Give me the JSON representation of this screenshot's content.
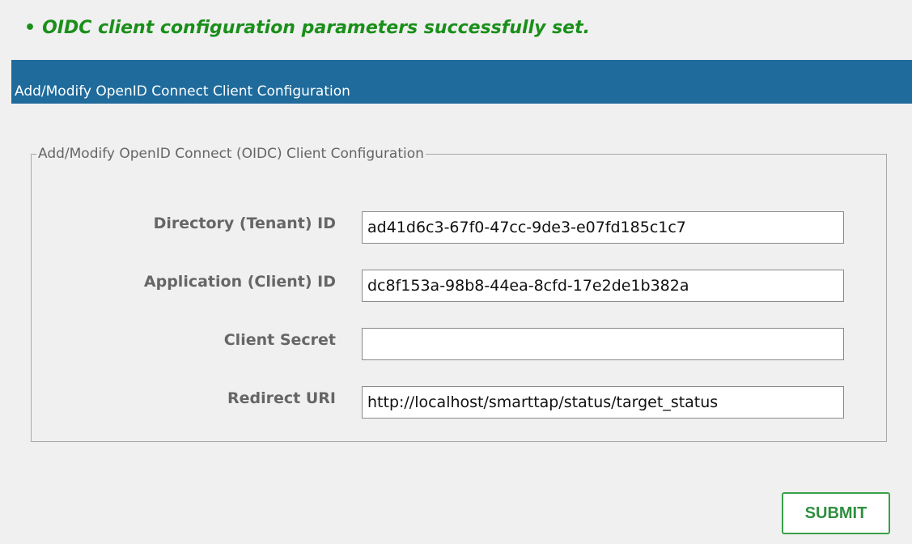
{
  "status": {
    "bullet": "•",
    "message": "OIDC client configuration parameters successfully set."
  },
  "panel": {
    "title": "Add/Modify OpenID Connect Client Configuration"
  },
  "form": {
    "legend": "Add/Modify OpenID Connect (OIDC) Client Configuration",
    "fields": [
      {
        "label": "Directory (Tenant) ID",
        "value": "ad41d6c3-67f0-47cc-9de3-e07fd185c1c7"
      },
      {
        "label": "Application (Client) ID",
        "value": "dc8f153a-98b8-44ea-8cfd-17e2de1b382a"
      },
      {
        "label": "Client Secret",
        "value": ""
      },
      {
        "label": "Redirect URI",
        "value": "http://localhost/smarttap/status/target_status"
      }
    ],
    "submit_label": "SUBMIT"
  },
  "colors": {
    "success_text": "#1a8f1a",
    "header_bg": "#1f6b9c",
    "submit_border": "#3aa04a",
    "background": "#f0f0f0"
  }
}
